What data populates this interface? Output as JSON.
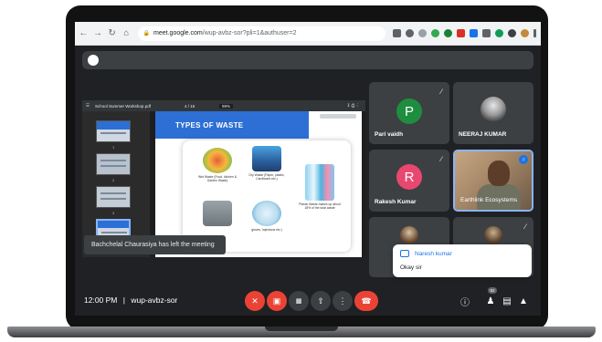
{
  "browser": {
    "url_domain": "meet.google.com",
    "url_path": "/wup-avbz-sor?pli=1&authuser=2"
  },
  "presentation": {
    "file_title": "School Summer Workshop.pdf",
    "page_indicator": "4 / 16",
    "zoom": "98%",
    "slide_title": "TYPES OF WASTE",
    "thumbnail_numbers": [
      "1",
      "2",
      "3"
    ],
    "items": [
      {
        "icon": "food-waste-icon",
        "caption": "Wet Waste (Food, kitchen & Garden Waste)"
      },
      {
        "icon": "dry-waste-icon",
        "caption": "Dry Waste (Paper, plastic, Cardboard etc.)"
      },
      {
        "icon": "plastic-waste-icon",
        "caption": "Plastic Waste makes up about 18% of the total waste"
      },
      {
        "icon": "recycle-bin-icon",
        "caption": ""
      },
      {
        "icon": "medical-waste-icon",
        "caption": "gloves, Injections etc.)"
      }
    ]
  },
  "notification": "Bachchelal Chaurasiya has left the meeting",
  "participants": [
    {
      "name": "Pari vaidh",
      "initial": "P",
      "color": "#1e8e3e",
      "muted": true
    },
    {
      "name": "NEERAJ KUMAR",
      "muted": false
    },
    {
      "name": "Rakesh Kumar",
      "initial": "R",
      "color": "#e8486f",
      "muted": true
    },
    {
      "name": "Earthlink Ecosystems",
      "muted": false,
      "speaking": true
    },
    {
      "name": "",
      "muted": false
    },
    {
      "name": "",
      "muted": true
    }
  ],
  "chat": {
    "sender": "Naresh kumar",
    "message": "Okay sir"
  },
  "bottom": {
    "time": "12:00 PM",
    "separator": "|",
    "meeting_code": "wup-avbz-sor",
    "participant_count": "82"
  }
}
